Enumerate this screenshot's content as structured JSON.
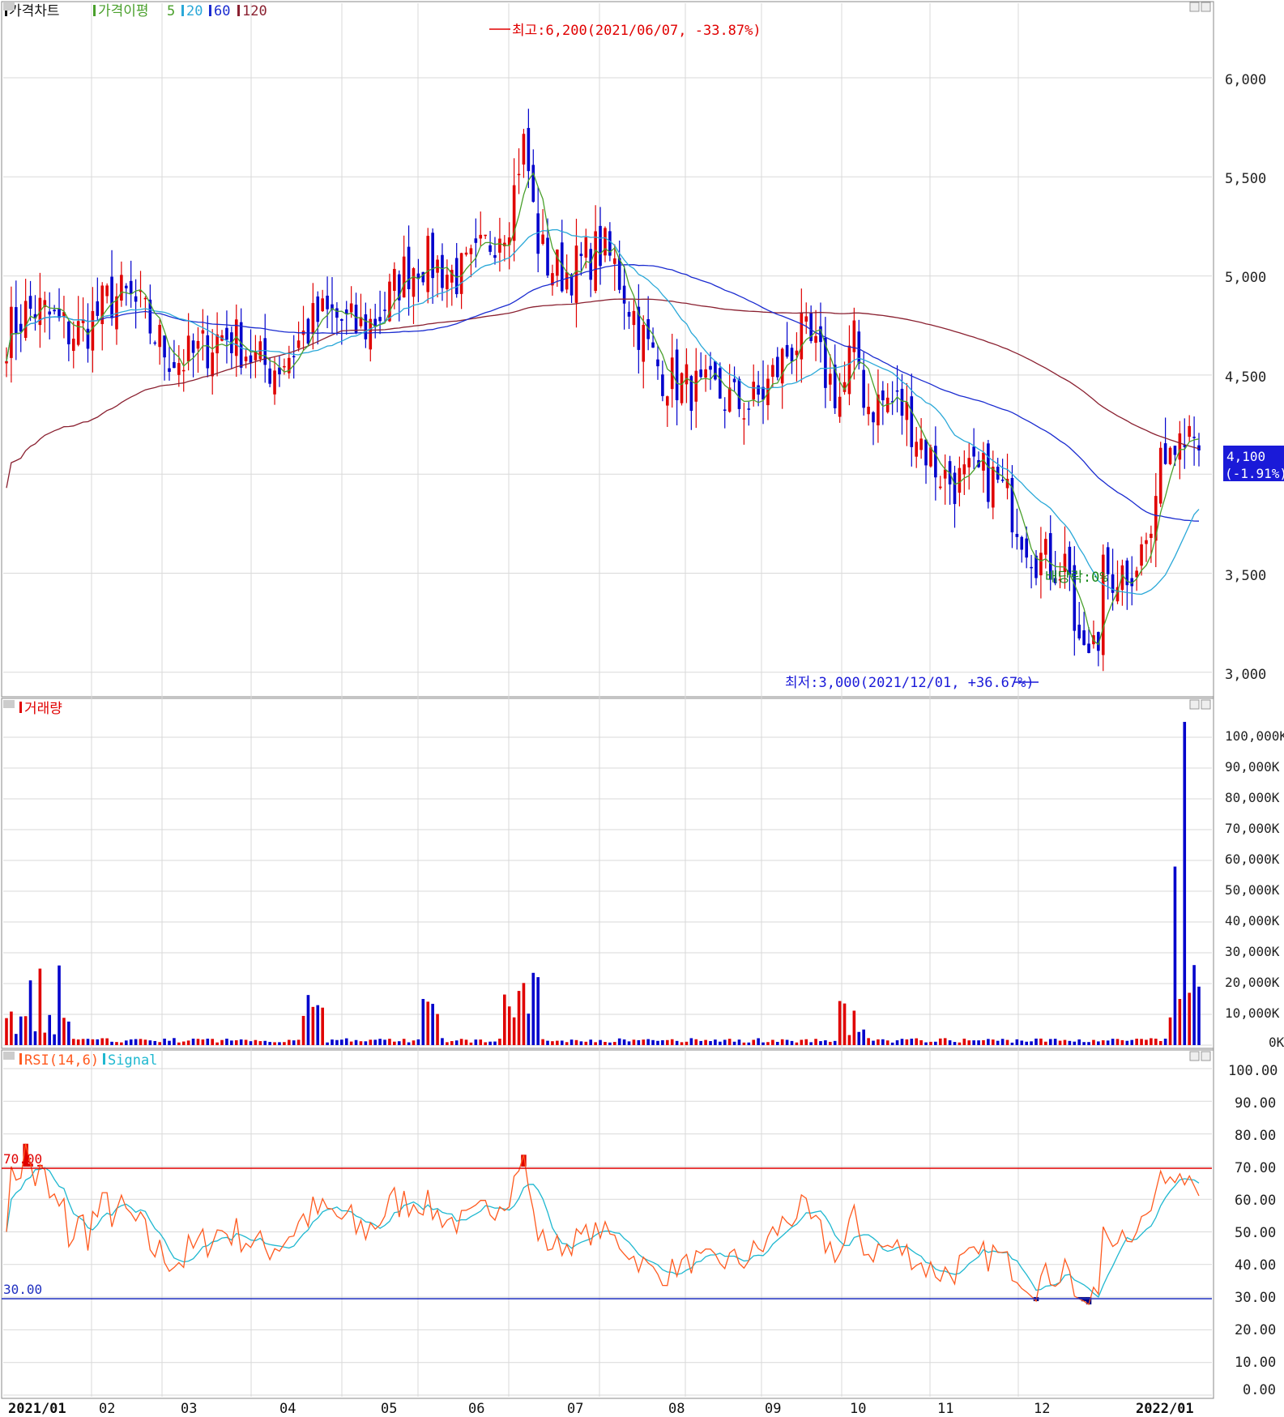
{
  "colors": {
    "up": "#e00000",
    "down": "#0000cc",
    "ma5": "#4aa02c",
    "ma20": "#2aa8d8",
    "ma60": "#1a2bd0",
    "ma120": "#8a2030",
    "rsi": "#ff5a1f",
    "signal": "#1fb8d0",
    "line70": "#e00000",
    "line30": "#2030c0",
    "grid": "#d9d9d9",
    "axis": "#222222",
    "current_badge_bg": "#1a1ad8",
    "current_badge_text": "#ffffff"
  },
  "price_panel": {
    "legend": {
      "price_label": "가격차트",
      "ma_label": "가격이평",
      "ma5": "5",
      "ma20": "20",
      "ma60": "60",
      "ma120": "120"
    },
    "y_ticks": [
      "6,000",
      "5,500",
      "5,000",
      "4,500",
      "3,500",
      "3,000"
    ],
    "high_annotation": "최고:6,200(2021/06/07, -33.87%)",
    "low_annotation": "최저:3,000(2021/12/01, +36.67%)",
    "dividend_annotation": "배당락:0%",
    "current_price": "4,100",
    "current_change": "(-1.91%)"
  },
  "volume_panel": {
    "legend": "거래량",
    "y_ticks": [
      "100,000K",
      "90,000K",
      "80,000K",
      "70,000K",
      "60,000K",
      "50,000K",
      "40,000K",
      "30,000K",
      "20,000K",
      "10,000K",
      "0K"
    ]
  },
  "rsi_panel": {
    "legend_rsi": "RSI(14,6)",
    "legend_signal": "Signal",
    "y_ticks": [
      "100.00",
      "90.00",
      "80.00",
      "70.00",
      "60.00",
      "50.00",
      "40.00",
      "30.00",
      "20.00",
      "10.00",
      "0.00"
    ],
    "level_70": "70.00",
    "level_30": "30.00"
  },
  "x_axis": {
    "labels": [
      "2021/01",
      "02",
      "03",
      "04",
      "05",
      "06",
      "07",
      "08",
      "09",
      "10",
      "11",
      "12",
      "2022/01"
    ]
  },
  "chart_data": [
    {
      "type": "candlestick",
      "title": "가격차트",
      "x_range": [
        "2021/01",
        "2022/01"
      ],
      "ylim": [
        3000,
        6200
      ],
      "series": [
        {
          "name": "5",
          "role": "moving-average"
        },
        {
          "name": "20",
          "role": "moving-average"
        },
        {
          "name": "60",
          "role": "moving-average"
        },
        {
          "name": "120",
          "role": "moving-average"
        }
      ],
      "high": {
        "value": 6200,
        "date": "2021/06/07",
        "change_pct": -33.87
      },
      "low": {
        "value": 3000,
        "date": "2021/12/01",
        "change_pct": 36.67
      },
      "last": {
        "value": 4100,
        "change_pct": -1.91
      },
      "monthly_close_approx": {
        "x": [
          "2021/01",
          "02",
          "03",
          "04",
          "05",
          "06",
          "07",
          "08",
          "09",
          "10",
          "11",
          "12",
          "2022/01"
        ],
        "values": [
          4700,
          4850,
          4600,
          4650,
          4950,
          5200,
          5050,
          4300,
          4600,
          4250,
          3850,
          3400,
          4100
        ]
      }
    },
    {
      "type": "bar",
      "title": "거래량",
      "unit": "K",
      "ylim": [
        0,
        105000
      ],
      "notable_values": [
        {
          "x": "2021/01",
          "value": 35000
        },
        {
          "x": "04",
          "value": 18000
        },
        {
          "x": "05",
          "value": 17000
        },
        {
          "x": "06",
          "value": 25000
        },
        {
          "x": "09",
          "value": 16000
        },
        {
          "x": "2022/01",
          "value": 105000
        }
      ]
    },
    {
      "type": "line",
      "title": "RSI(14,6)",
      "ylim": [
        0,
        100
      ],
      "series": [
        {
          "name": "RSI(14,6)"
        },
        {
          "name": "Signal"
        }
      ],
      "reference_lines": [
        70,
        30
      ]
    }
  ]
}
